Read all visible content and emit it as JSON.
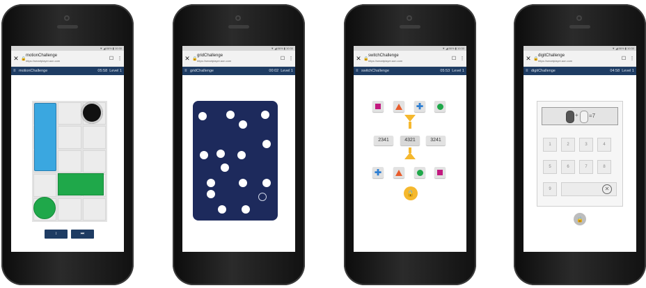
{
  "status_text": "▼ ◢ 86% ▮ 10:30",
  "url": "https://smartplayer.aon.com",
  "phones": [
    {
      "tab_title": "motionChallenge",
      "nav_title": "motionChallenge",
      "timer": "05:58",
      "level": "Level 1",
      "buttons": [
        "↕",
        "⏭"
      ]
    },
    {
      "tab_title": "gridChallenge",
      "nav_title": "gridChallenge",
      "timer": "00:02",
      "level": "Level 1"
    },
    {
      "tab_title": "switchChallenge",
      "nav_title": "switchChallenge",
      "timer": "05:53",
      "level": "Level 1",
      "numbers": [
        "2341",
        "4321",
        "3241"
      ]
    },
    {
      "tab_title": "digitChallenge",
      "nav_title": "digitChallenge",
      "timer": "04:58",
      "level": "Level 1",
      "equation": "=7",
      "keys": [
        "1",
        "2",
        "3",
        "4",
        "5",
        "6",
        "7",
        "8",
        "9"
      ]
    }
  ],
  "colors": {
    "nav": "#1e3c63",
    "grid_board": "#1d2a5c",
    "lock": "#f5b82e",
    "switch_accent": "#f5b82e",
    "pink": "#c2197f",
    "orange": "#e85c2c",
    "blue": "#2f7fd2",
    "green": "#1fa84a",
    "cyan": "#3aa7e0"
  },
  "icons": {
    "close": "close-icon",
    "lock": "lock-icon",
    "bookmark": "bookmark-icon",
    "menu": "menu-icon",
    "more": "more-icon"
  }
}
